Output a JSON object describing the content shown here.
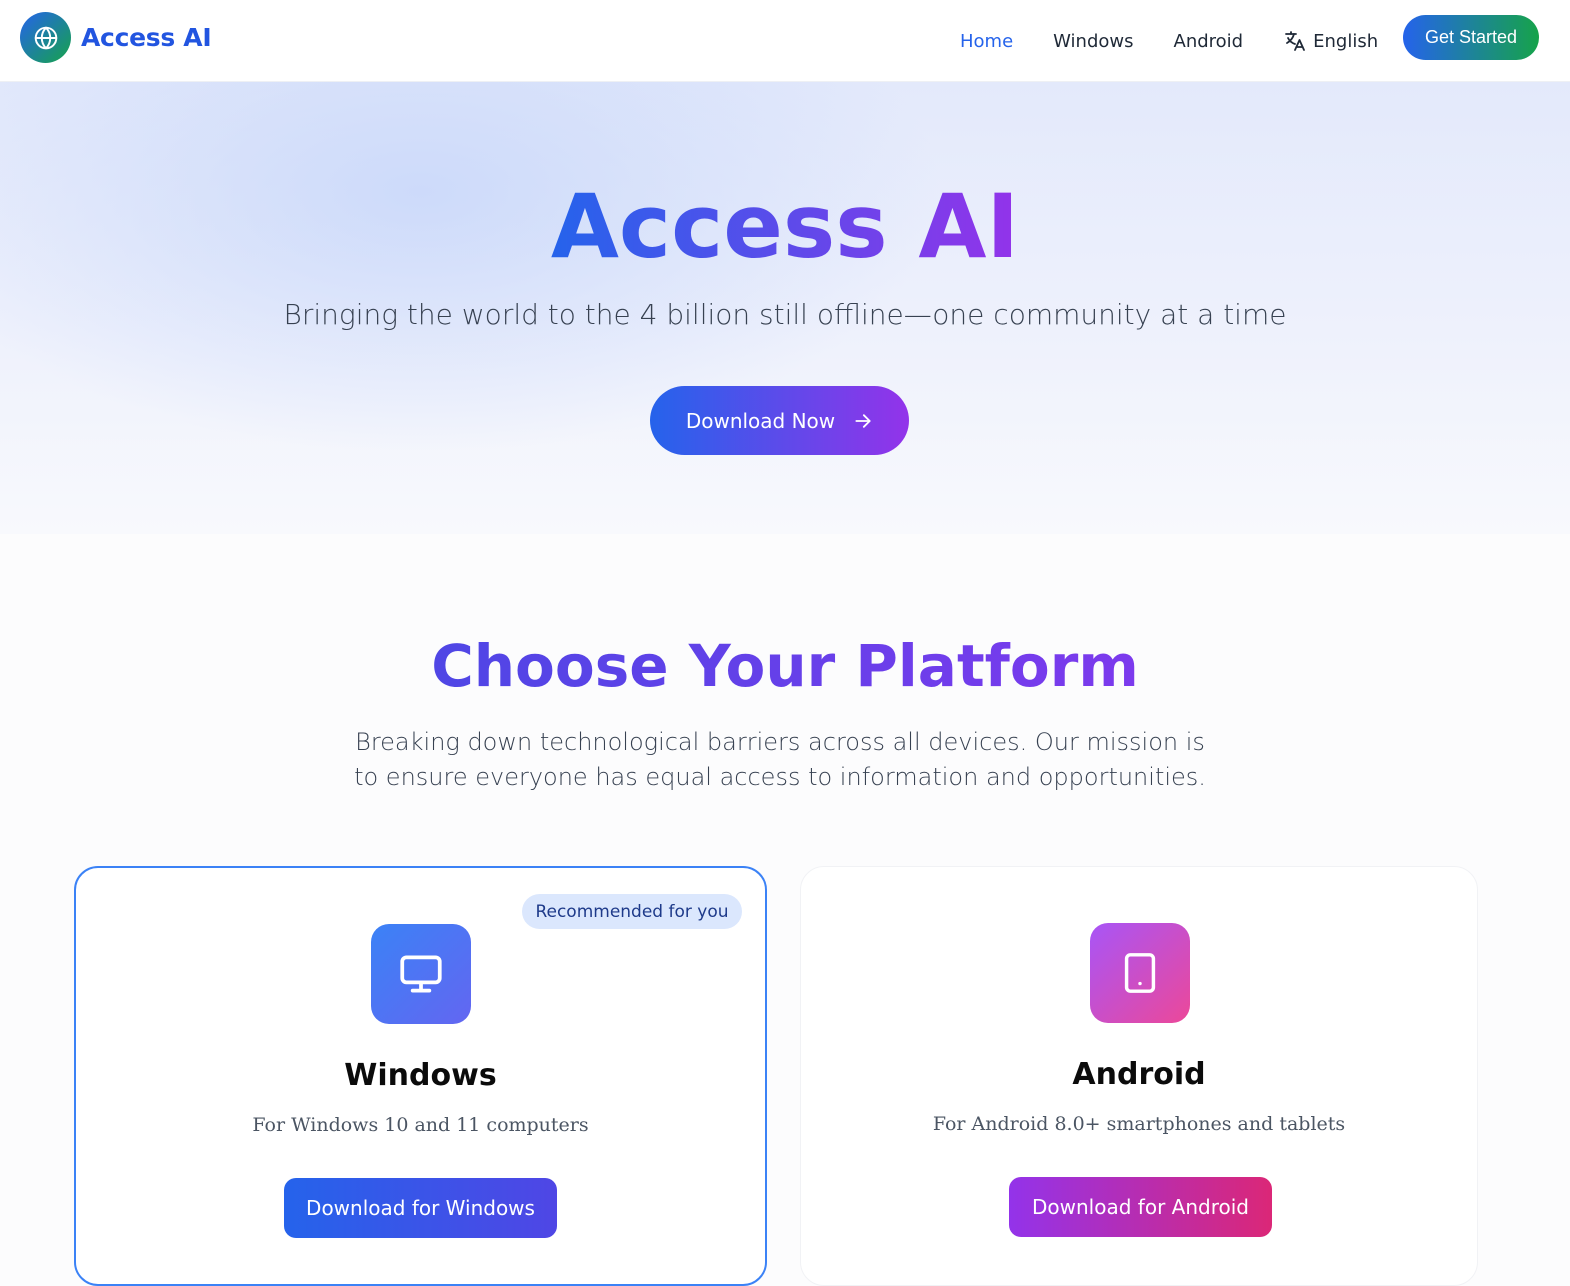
{
  "brand": {
    "name": "Access AI",
    "logo_icon": "globe-icon"
  },
  "nav": {
    "links": [
      {
        "label": "Home",
        "active": true
      },
      {
        "label": "Windows",
        "active": false
      },
      {
        "label": "Android",
        "active": false
      }
    ],
    "language": {
      "label": "English",
      "icon": "translate-icon"
    },
    "cta_label": "Get Started"
  },
  "hero": {
    "title": "Access AI",
    "subtitle": "Bringing the world to the 4 billion still offline—one community at a time",
    "download_label": "Download Now",
    "download_icon": "arrow-right-icon"
  },
  "platforms": {
    "title": "Choose Your Platform",
    "description": "Breaking down technological barriers across all devices. Our mission is to ensure everyone has equal access to information and opportunities.",
    "cards": [
      {
        "name": "Windows",
        "badge": "Recommended for you",
        "icon": "monitor-icon",
        "requirements": "For Windows 10 and 11 computers",
        "button_label": "Download for Windows"
      },
      {
        "name": "Android",
        "icon": "tablet-icon",
        "requirements": "For Android 8.0+ smartphones and tablets",
        "button_label": "Download for Android"
      }
    ]
  },
  "colors": {
    "primary": "#2563eb",
    "purple": "#9333ea",
    "green": "#16a34a",
    "pink": "#db2777"
  }
}
